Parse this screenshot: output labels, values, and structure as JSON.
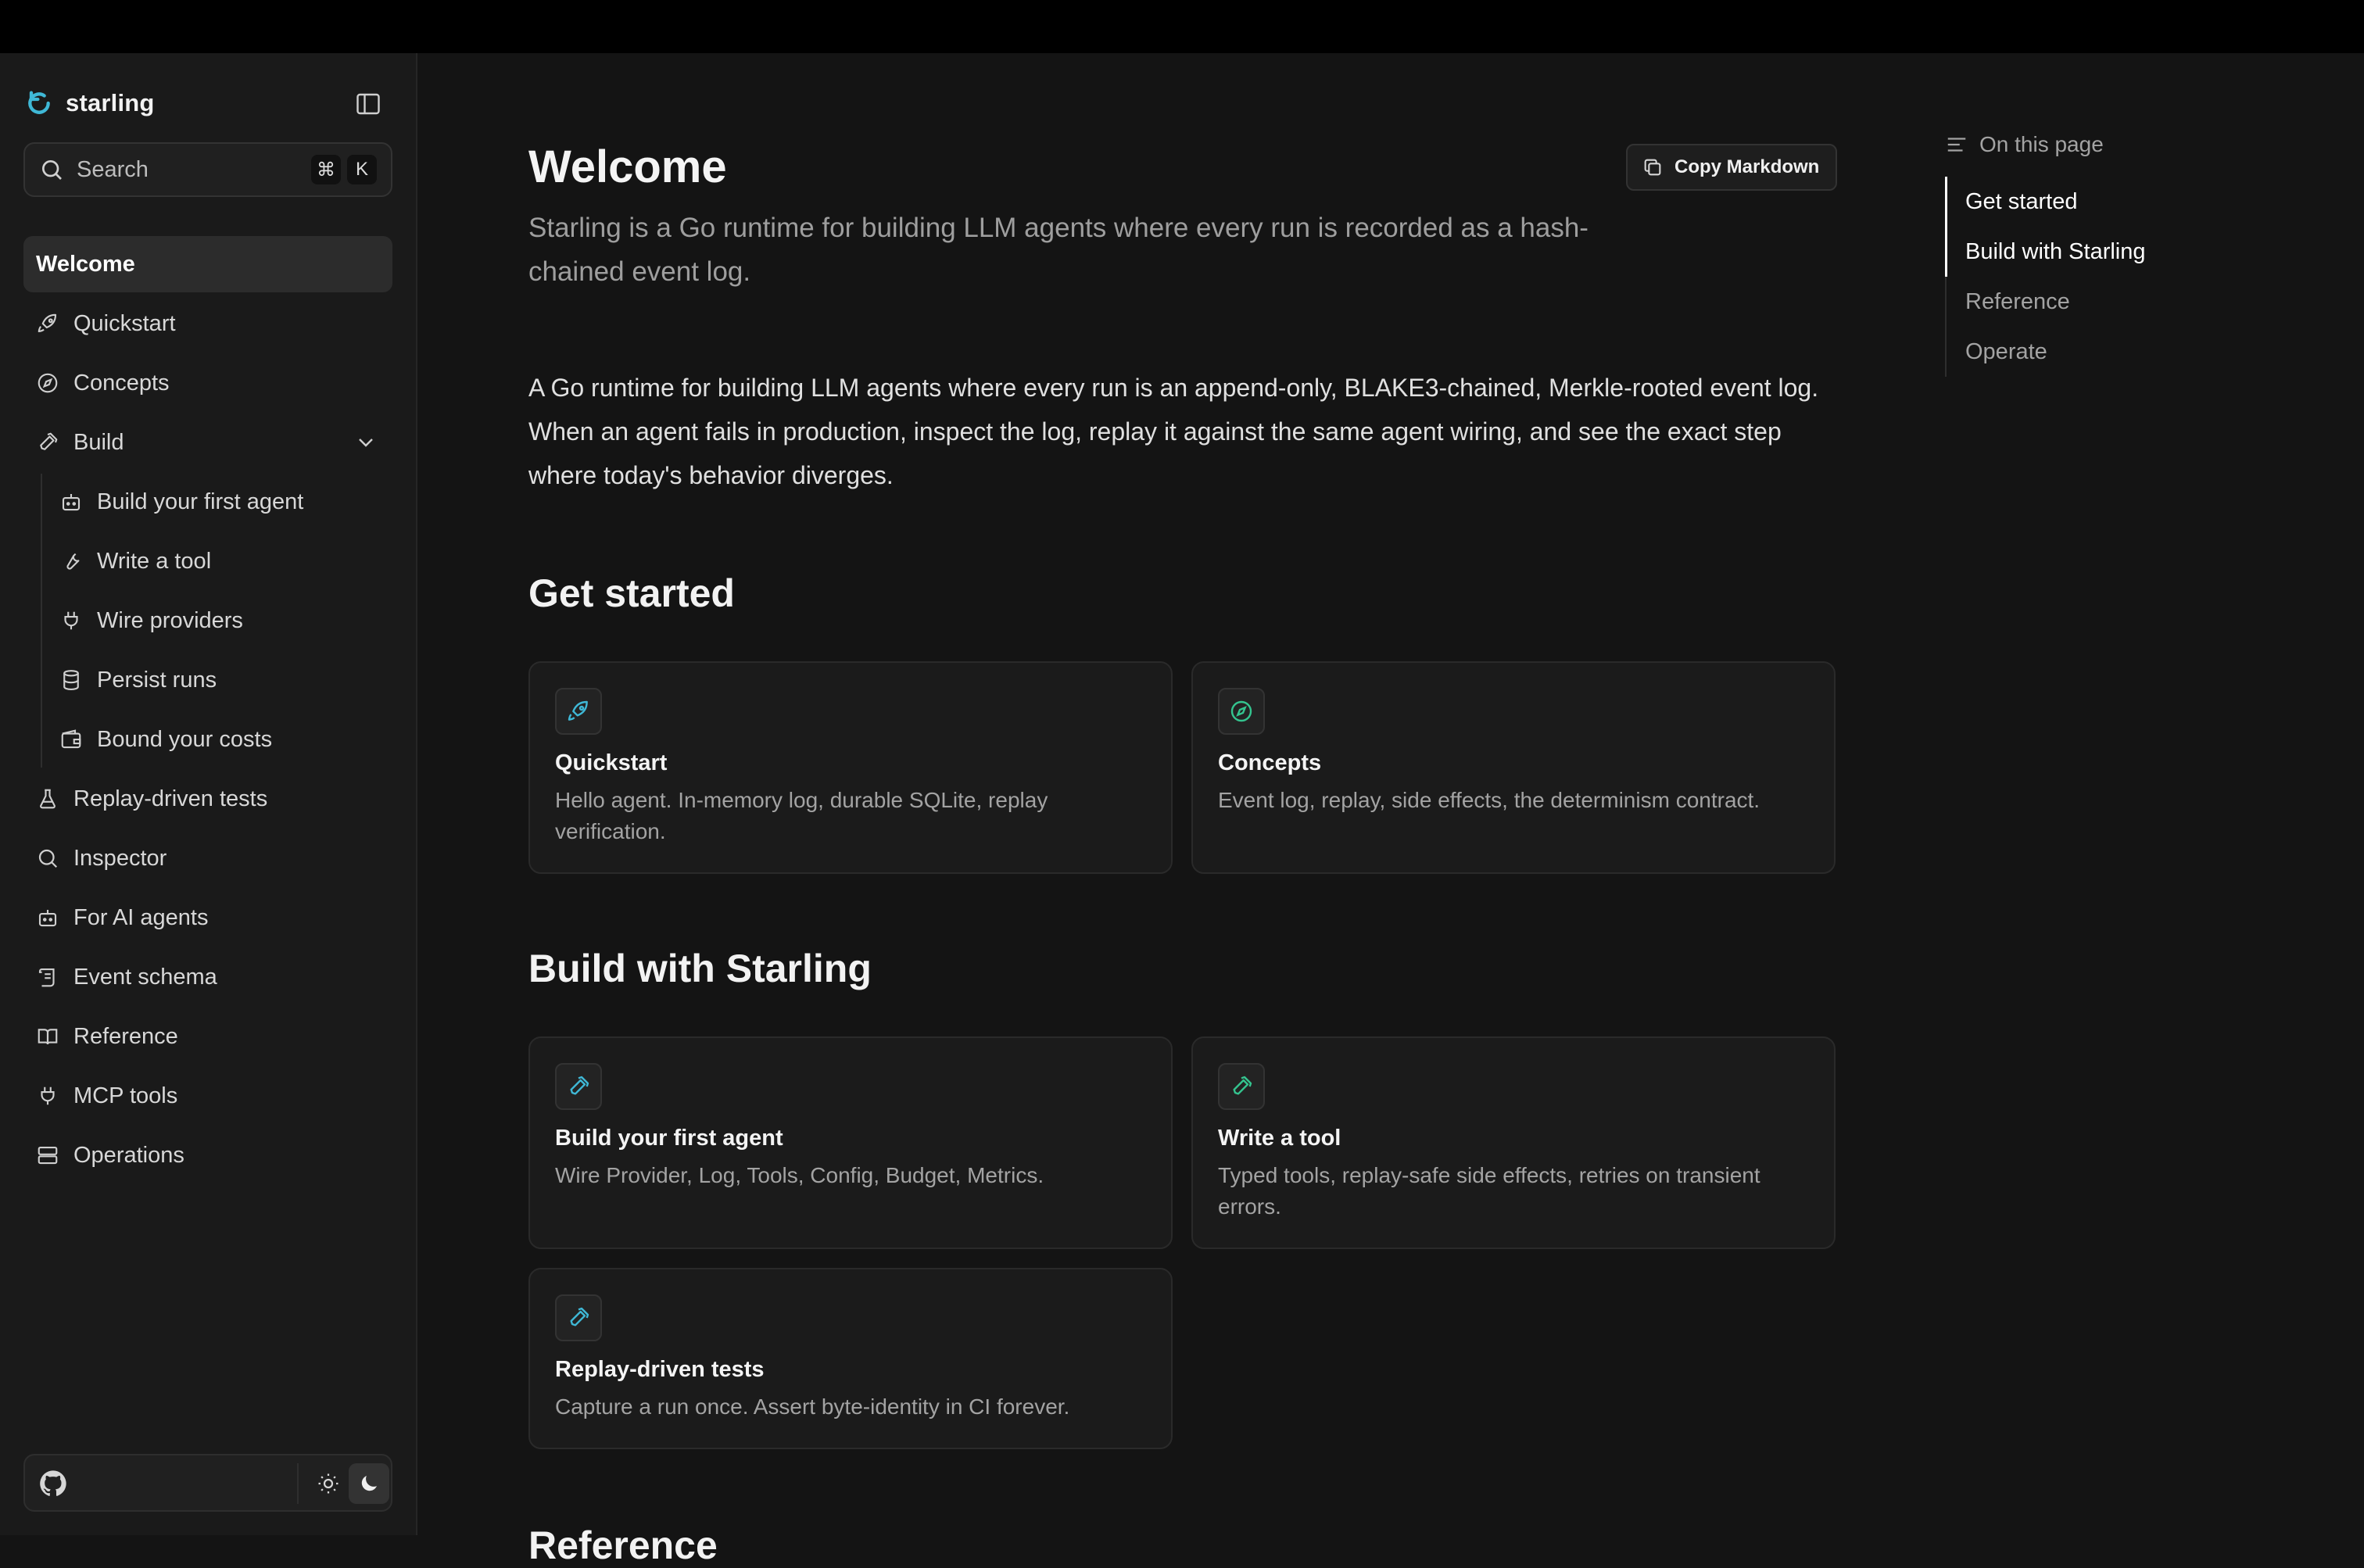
{
  "brand": {
    "name": "starling",
    "accent": "#3fb8d6"
  },
  "search": {
    "placeholder": "Search",
    "shortcut_mod": "⌘",
    "shortcut_key": "K"
  },
  "nav": {
    "items": [
      {
        "label": "Welcome",
        "icon": "none",
        "active": true
      },
      {
        "label": "Quickstart",
        "icon": "rocket-icon"
      },
      {
        "label": "Concepts",
        "icon": "compass-icon"
      },
      {
        "label": "Build",
        "icon": "hammer-icon",
        "expanded": true
      },
      {
        "label": "Replay-driven tests",
        "icon": "flask-icon"
      },
      {
        "label": "Inspector",
        "icon": "search-icon"
      },
      {
        "label": "For AI agents",
        "icon": "bot-icon"
      },
      {
        "label": "Event schema",
        "icon": "scroll-icon"
      },
      {
        "label": "Reference",
        "icon": "book-icon"
      },
      {
        "label": "MCP tools",
        "icon": "plug-icon"
      },
      {
        "label": "Operations",
        "icon": "server-icon"
      }
    ],
    "build_children": [
      {
        "label": "Build your first agent",
        "icon": "bot-icon"
      },
      {
        "label": "Write a tool",
        "icon": "wrench-icon"
      },
      {
        "label": "Wire providers",
        "icon": "plug-icon"
      },
      {
        "label": "Persist runs",
        "icon": "database-icon"
      },
      {
        "label": "Bound your costs",
        "icon": "wallet-icon"
      }
    ]
  },
  "page": {
    "title": "Welcome",
    "subtitle": "Starling is a Go runtime for building LLM agents where every run is recorded as a hash-chained event log.",
    "copy_label": "Copy Markdown",
    "intro": "A Go runtime for building LLM agents where every run is an append-only, BLAKE3-chained, Merkle-rooted event log. When an agent fails in production, inspect the log, replay it against the same agent wiring, and see the exact step where today's behavior diverges.",
    "sections": [
      {
        "heading": "Get started",
        "cards": [
          {
            "title": "Quickstart",
            "desc": "Hello agent. In-memory log, durable SQLite, replay verification.",
            "icon": "rocket-icon",
            "color": "#3fb8d6"
          },
          {
            "title": "Concepts",
            "desc": "Event log, replay, side effects, the determinism contract.",
            "icon": "compass-icon",
            "color": "#34c48f"
          }
        ]
      },
      {
        "heading": "Build with Starling",
        "cards": [
          {
            "title": "Build your first agent",
            "desc": "Wire Provider, Log, Tools, Config, Budget, Metrics.",
            "icon": "hammer-icon",
            "color": "#3fb8d6"
          },
          {
            "title": "Write a tool",
            "desc": "Typed tools, replay-safe side effects, retries on transient errors.",
            "icon": "hammer-icon",
            "color": "#34c48f"
          },
          {
            "title": "Replay-driven tests",
            "desc": "Capture a run once. Assert byte-identity in CI forever.",
            "icon": "hammer-icon",
            "color": "#3fb8d6"
          }
        ]
      }
    ],
    "next_heading": "Reference"
  },
  "toc": {
    "header": "On this page",
    "items": [
      {
        "label": "Get started",
        "active": true
      },
      {
        "label": "Build with Starling",
        "active": true
      },
      {
        "label": "Reference"
      },
      {
        "label": "Operate"
      }
    ]
  }
}
